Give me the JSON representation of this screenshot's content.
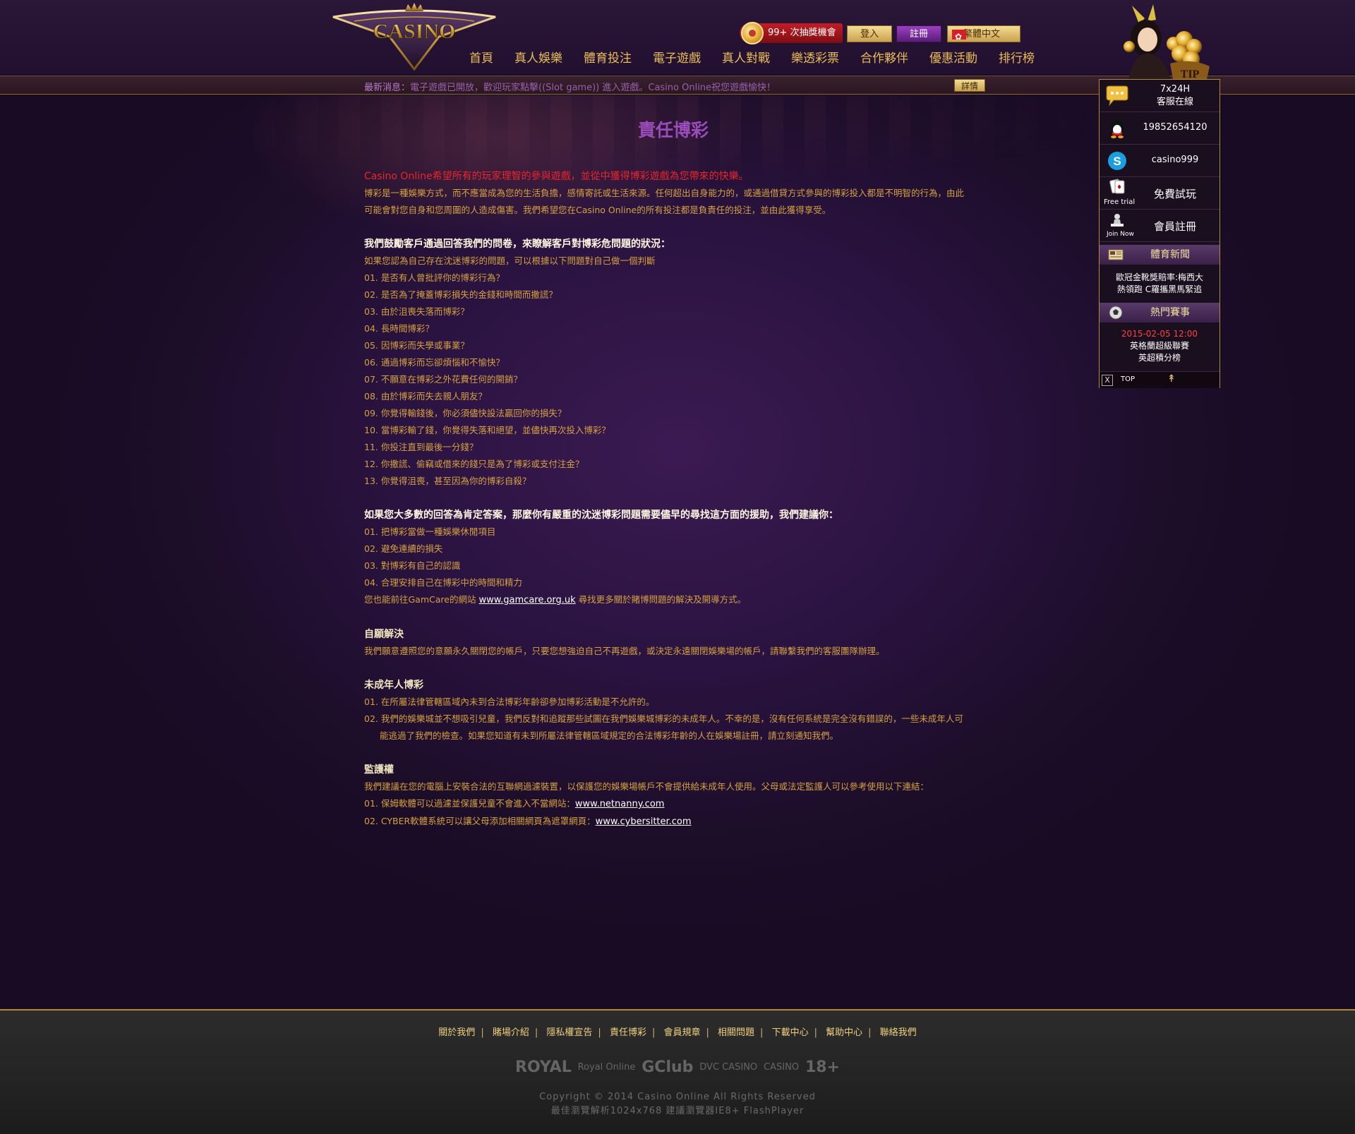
{
  "brand": {
    "logo_text": "CASINO"
  },
  "top_actions": {
    "lottery": "99+ 次抽獎機會",
    "login": "登入",
    "register": "註冊",
    "language": "繁體中文"
  },
  "nav": [
    "首頁",
    "真人娛樂",
    "體育投注",
    "電子遊戲",
    "真人對戰",
    "樂透彩票",
    "合作夥伴",
    "優惠活動",
    "排行榜"
  ],
  "ticker": {
    "label": "最新消息：",
    "text": "電子遊戲已開放，歡迎玩家點擊((Slot game)) 進入遊戲。Casino Online祝您遊戲愉快！",
    "details": "詳情"
  },
  "page": {
    "title": "責任博彩",
    "intro_red": "Casino Online希望所有的玩家理智的參與遊戲，並從中獲得博彩遊戲為您帶來的快樂。",
    "intro_body": "博彩是一種娛樂方式，而不應當成為您的生活負擔，感情寄託或生活來源。任何超出自身能力的，或通過借貸方式參與的博彩投入都是不明智的行為，由此可能會對您自身和您周圍的人造成傷害。我們希望您在Casino Online的所有投注都是負責任的投注，並由此獲得享受。",
    "questionnaire": {
      "heading": "我們鼓勵客戶通過回答我們的問卷，來瞭解客戶對博彩危問題的狀況：",
      "sub": "如果您認為自己存在沈迷博彩的問題，可以根據以下問題對自己做一個判斷",
      "items": [
        "01. 是否有人曾批評你的博彩行為？",
        "02. 是否為了掩蓋博彩損失的金錢和時間而撒謊？",
        "03. 由於沮喪失落而博彩？",
        "04. 長時間博彩？",
        "05. 因博彩而失學或事業？",
        "06. 通過博彩而忘卻煩惱和不愉快？",
        "07. 不願意在博彩之外花費任何的開銷？",
        "08. 由於博彩而失去親人朋友？",
        "09. 你覺得輸錢後，你必須儘快設法贏回你的損失？",
        "10. 當博彩輸了錢，你覺得失落和絕望，並儘快再次投入博彩？",
        "11. 你投注直到最後一分錢？",
        "12. 你撒謊、偷竊或借來的錢只是為了博彩或支付注金？",
        "13. 你覺得沮喪，甚至因為你的博彩自殺？"
      ]
    },
    "advice": {
      "heading": "如果您大多數的回答為肯定答案，那麼你有嚴重的沈迷博彩問題需要儘早的尋找這方面的援助，我們建議你：",
      "items": [
        "01. 把博彩當做一種娛樂休閒項目",
        "02. 避免連續的損失",
        "03. 對博彩有自己的認識",
        "04. 合理安排自己在博彩中的時間和精力"
      ],
      "gamcare_pre": "您也能前往GamCare的網站 ",
      "gamcare_link": "www.gamcare.org.uk",
      "gamcare_post": " 尋找更多關於賭博問題的解決及開導方式。"
    },
    "self_exclusion": {
      "heading": "自願解決",
      "body": "我們願意遵照您的意願永久關閉您的帳戶，只要您想強迫自己不再遊戲，或決定永遠關閉娛樂場的帳戶，請聯繫我們的客服團隊辦理。"
    },
    "underage": {
      "heading": "未成年人博彩",
      "item1": "01. 在所屬法律管轄區域內未到合法博彩年齡卻參加博彩活動是不允許的。",
      "item2": "02. 我們的娛樂城並不想吸引兒童，我們反對和追蹤那些試圖在我們娛樂城博彩的未成年人。不幸的是，沒有任何系統是完全沒有錯誤的，一些未成年人可能逃過了我們的檢查。如果您知道有未到所屬法律管轄區域規定的合法博彩年齡的人在娛樂場註冊，請立刻通知我們。"
    },
    "guardianship": {
      "heading": "監護權",
      "body": "我們建議在您的電腦上安裝合法的互聯網過濾裝置，以保護您的娛樂場帳戶不會提供給未成年人使用。父母或法定監護人可以參考使用以下連結：",
      "item1_pre": "01. 保姆軟體可以過濾並保護兒童不會進入不當網站：",
      "item1_link": "www.netnanny.com",
      "item2_pre": "02. CYBER軟體系統可以讓父母添加相關網頁為遮罩網頁：",
      "item2_link": "www.cybersitter.com"
    }
  },
  "side_panel": {
    "tip_label": "TIP",
    "service_line1": "7x24H",
    "service_line2": "客服在線",
    "qq": "19852654120",
    "skype": "casino999",
    "free_trial_icon_label": "Free trial",
    "free_trial": "免費試玩",
    "join_icon_label": "Join Now",
    "member_register": "會員註冊",
    "sports_news_heading": "體育新聞",
    "sports_news_line1": "歐冠金靴獎賠率:梅西大",
    "sports_news_line2": "熱領跑 C羅攜黑馬緊追",
    "hot_matches_heading": "熱門賽事",
    "match_time": "2015-02-05 12:00",
    "match_league": "英格蘭超級聯賽",
    "match_name": "英超積分榜",
    "close": "X",
    "top": "TOP"
  },
  "footer": {
    "links": [
      "關於我們",
      "賭場介紹",
      "隱私權宣告",
      "責任博彩",
      "會員規章",
      "相關問題",
      "下載中心",
      "幫助中心",
      "聯絡我們"
    ],
    "partners": [
      "ROYAL",
      "Royal Online",
      "GClub",
      "DVC CASINO",
      "CASINO",
      "18+"
    ],
    "copyright": "Copyright © 2014 Casino Online All Rights Reserved",
    "browser_note": "最佳瀏覽解析1024x768 建議瀏覽器IE8+ FlashPlayer"
  },
  "colors": {
    "accent_gold": "#d4a140",
    "accent_purple": "#9a4dba",
    "alert_red": "#e8262c",
    "background": "#1c0d26"
  }
}
